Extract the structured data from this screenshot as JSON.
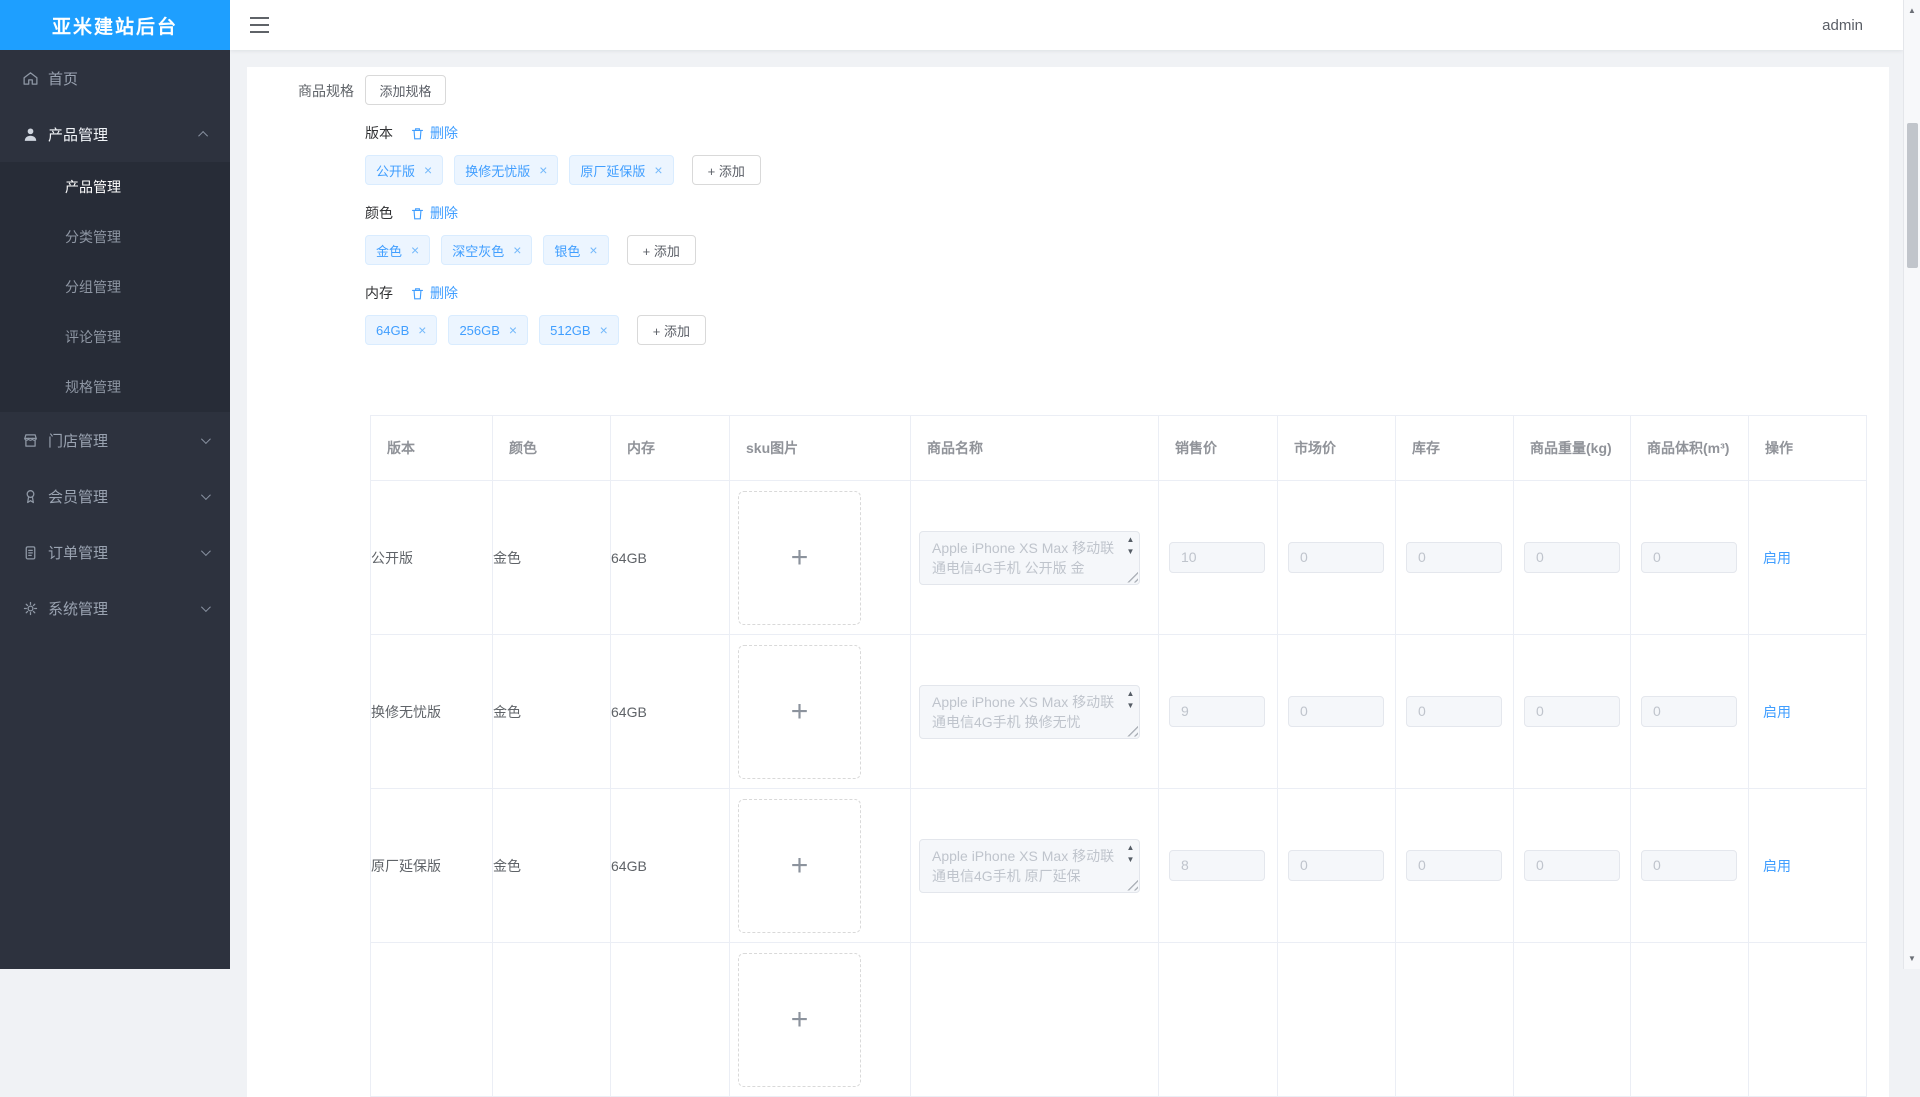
{
  "app": {
    "title": "亚米建站后台",
    "user": "admin"
  },
  "sidebar": {
    "home": "首页",
    "product": "产品管理",
    "product_sub": [
      "产品管理",
      "分类管理",
      "分组管理",
      "评论管理",
      "规格管理"
    ],
    "store": "门店管理",
    "member": "会员管理",
    "order": "订单管理",
    "system": "系统管理"
  },
  "spec": {
    "label": "商品规格",
    "add_spec": "添加规格",
    "delete": "删除",
    "add_tag": "+ 添加",
    "groups": [
      {
        "name": "版本",
        "tags": [
          "公开版",
          "换修无忧版",
          "原厂延保版"
        ]
      },
      {
        "name": "颜色",
        "tags": [
          "金色",
          "深空灰色",
          "银色"
        ]
      },
      {
        "name": "内存",
        "tags": [
          "64GB",
          "256GB",
          "512GB"
        ]
      }
    ]
  },
  "table": {
    "headers": [
      "版本",
      "颜色",
      "内存",
      "sku图片",
      "商品名称",
      "销售价",
      "市场价",
      "库存",
      "商品重量(kg)",
      "商品体积(m³)",
      "操作"
    ],
    "rows": [
      {
        "version": "公开版",
        "color": "金色",
        "memory": "64GB",
        "name": "Apple iPhone XS Max 移动联通电信4G手机 公开版 金",
        "price": "10",
        "market": "0",
        "stock": "0",
        "weight": "0",
        "volume": "0",
        "action": "启用"
      },
      {
        "version": "换修无忧版",
        "color": "金色",
        "memory": "64GB",
        "name": "Apple iPhone XS Max 移动联通电信4G手机 换修无忧",
        "price": "9",
        "market": "0",
        "stock": "0",
        "weight": "0",
        "volume": "0",
        "action": "启用"
      },
      {
        "version": "原厂延保版",
        "color": "金色",
        "memory": "64GB",
        "name": "Apple iPhone XS Max 移动联通电信4G手机 原厂延保",
        "price": "8",
        "market": "0",
        "stock": "0",
        "weight": "0",
        "volume": "0",
        "action": "启用"
      },
      {
        "version": "",
        "color": "",
        "memory": "",
        "name": "",
        "price": "",
        "market": "",
        "stock": "",
        "weight": "",
        "volume": "",
        "action": ""
      }
    ]
  },
  "icons": {
    "close": "×",
    "plus": "+",
    "scroll_up": "▲",
    "scroll_down": "▼"
  },
  "colors": {
    "primary": "#409eff",
    "logo_bg": "#1e9fff",
    "tag_bg": "#ecf5ff",
    "tag_border": "#d9ecff",
    "sidebar_bg": "#2d323e"
  }
}
